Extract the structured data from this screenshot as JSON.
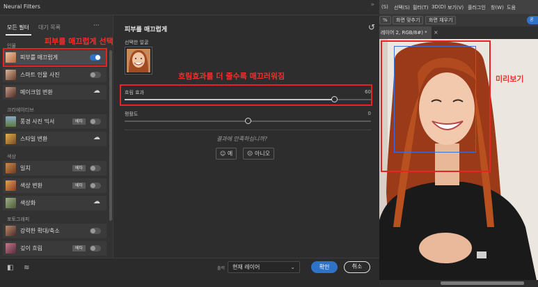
{
  "window": {
    "title": "Neural Filters",
    "more_icon": "more-dots-icon"
  },
  "tabs": {
    "all": "모든 필터",
    "waitlist": "대기 목록",
    "more": "···"
  },
  "categories": {
    "portrait": "인물",
    "creative": "크리에이티브",
    "color": "색상",
    "photography": "포토그래피"
  },
  "filters": [
    {
      "label": "피부를 매끄럽게",
      "active": true,
      "toggle": "on"
    },
    {
      "label": "스마트 인물 사진",
      "toggle": "off"
    },
    {
      "label": "메이크업 변환",
      "cloud": true
    },
    {
      "label": "풍경 사진 믹서",
      "badge": "베타",
      "toggle": "off"
    },
    {
      "label": "스타일 변환",
      "cloud": true
    },
    {
      "label": "일치",
      "badge": "베타",
      "toggle": "off"
    },
    {
      "label": "색상 변환",
      "badge": "베타",
      "toggle": "off"
    },
    {
      "label": "색상화",
      "cloud": true
    },
    {
      "label": "강력한 확대/축소",
      "toggle": "off"
    },
    {
      "label": "깊이 흐림",
      "badge": "베타",
      "toggle": "off"
    }
  ],
  "panel": {
    "title": "피부를 매끄럽게",
    "selected_face_label": "선택한 얼굴",
    "blur": {
      "label": "흐림 효과",
      "value": "60",
      "fraction": 0.85
    },
    "smoothness": {
      "label": "평활도",
      "value": "0",
      "fraction": 0.5
    },
    "feedback_question": "결과에 만족하십니까?",
    "yes": "예",
    "no": "아니오"
  },
  "bottom": {
    "output_label": "출력",
    "output_value": "현재 레이어",
    "ok": "확인",
    "cancel": "취소"
  },
  "annotations": {
    "filter": "피부를 매끄럽게 선택",
    "blur": "흐림효과를 더 줄수록 매끄러워짐",
    "preview": "미리보기"
  },
  "ps": {
    "menu": [
      "(S)",
      "선택(S)",
      "필터(T)",
      "3D(D)",
      "보기(V)",
      "플러그인",
      "창(W)",
      "도움"
    ],
    "options": {
      "pct": "%",
      "fit": "화면 맞추기",
      "fill": "화면 채우기",
      "blue": "공"
    },
    "doc_tab": "레이어 2, RGB/8#) *"
  },
  "colors": {
    "accent": "#2f73c8",
    "annotation": "#e52424",
    "face_box": "#3f6fd0"
  }
}
